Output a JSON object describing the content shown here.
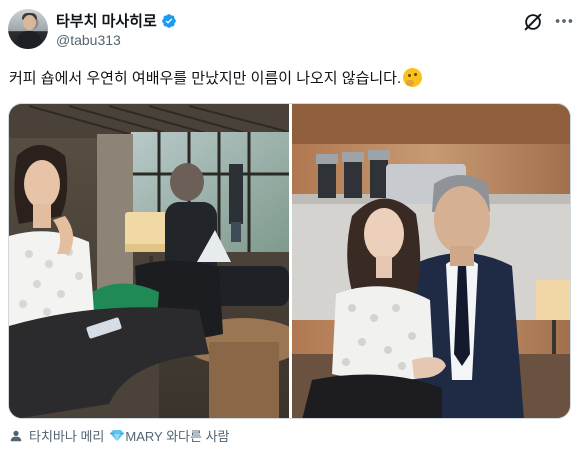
{
  "author": {
    "display_name": "타부치 마사히로",
    "handle": "@tabu313",
    "verified": true
  },
  "tweet": {
    "text": "커피 숍에서 우연히 여배우를 만났지만 이름이 나오지 않습니다.",
    "emoji": "thinking-face"
  },
  "media": {
    "count": 2
  },
  "tagged": {
    "text_before": "타치바나 메리",
    "text_after": "MARY 와다른 사람",
    "gem_icon": "gem-icon"
  },
  "colors": {
    "verified_blue": "#1d9bf0",
    "secondary_text": "#536471",
    "border": "#cfd9de"
  }
}
